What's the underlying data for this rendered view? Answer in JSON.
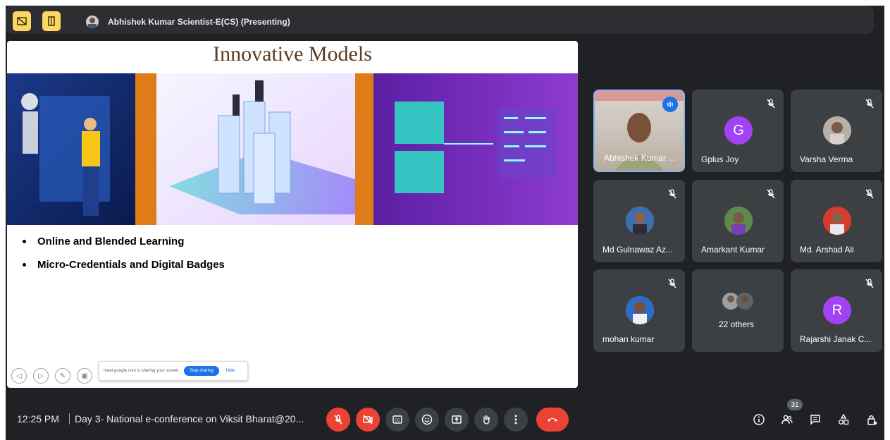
{
  "presenter": {
    "name": "Abhishek Kumar Scientist-E(CS) (Presenting)"
  },
  "slide": {
    "title": "Innovative Models",
    "bullets": [
      "Online and Blended Learning",
      "Micro-Credentials and Digital Badges"
    ],
    "share_notice": {
      "text": "meet.google.com is sharing your screen.",
      "stop_label": "Stop sharing",
      "hide_label": "Hide"
    }
  },
  "participants": [
    {
      "name": "Abhishek Kumar ...",
      "type": "video",
      "speaking": true
    },
    {
      "name": "Gplus Joy",
      "type": "letter",
      "letter": "G",
      "color": "#a142f4",
      "muted": true
    },
    {
      "name": "Varsha Verma",
      "type": "photo",
      "muted": true
    },
    {
      "name": "Md Gulnawaz Az...",
      "type": "photo",
      "muted": true
    },
    {
      "name": "Amarkant Kumar",
      "type": "photo",
      "muted": true
    },
    {
      "name": "Md. Arshad Ali",
      "type": "photo",
      "muted": true
    },
    {
      "name": "mohan kumar",
      "type": "photo",
      "muted": true
    },
    {
      "name": "22 others",
      "type": "group"
    },
    {
      "name": "Rajarshi Janak C...",
      "type": "letter",
      "letter": "R",
      "color": "#a142f4",
      "muted": true
    }
  ],
  "bottombar": {
    "time": "12:25 PM",
    "meeting_title": "Day 3- National e-conference on Viksit Bharat@20...",
    "participant_count": "31"
  },
  "colors": {
    "background": "#202124",
    "tile": "#3c4043",
    "danger": "#ea4335",
    "accent": "#fdd663",
    "speaking": "#1a73e8"
  }
}
